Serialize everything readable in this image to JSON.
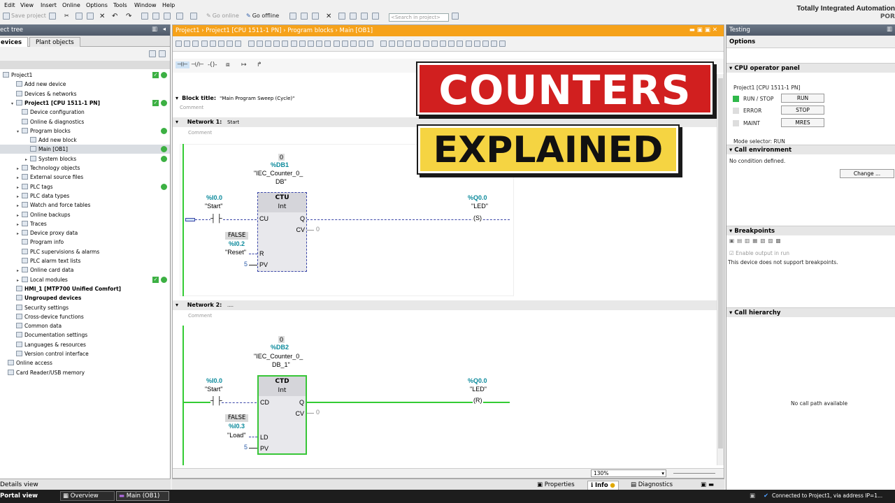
{
  "menu": [
    "Edit",
    "View",
    "Insert",
    "Online",
    "Options",
    "Tools",
    "Window",
    "Help"
  ],
  "toolbar": {
    "save": "Save project",
    "go_online": "Go online",
    "go_offline": "Go offline",
    "search_placeholder": "<Search in project>"
  },
  "app": {
    "title": "Totally Integrated Automation",
    "subtitle": "POR"
  },
  "tree": {
    "header": "ect tree",
    "tab_devices": "evices",
    "tab_plant": "Plant objects",
    "items": [
      {
        "label": "Project1",
        "indent": 0
      },
      {
        "label": "Add new device",
        "indent": 1
      },
      {
        "label": "Devices & networks",
        "indent": 1
      },
      {
        "label": "Project1 [CPU 1511-1 PN]",
        "indent": 1,
        "bold": true
      },
      {
        "label": "Device configuration",
        "indent": 2
      },
      {
        "label": "Online & diagnostics",
        "indent": 2
      },
      {
        "label": "Program blocks",
        "indent": 2
      },
      {
        "label": "Add new block",
        "indent": 3
      },
      {
        "label": "Main [OB1]",
        "indent": 3
      },
      {
        "label": "System blocks",
        "indent": 3
      },
      {
        "label": "Technology objects",
        "indent": 2
      },
      {
        "label": "External source files",
        "indent": 2
      },
      {
        "label": "PLC tags",
        "indent": 2
      },
      {
        "label": "PLC data types",
        "indent": 2
      },
      {
        "label": "Watch and force tables",
        "indent": 2
      },
      {
        "label": "Online backups",
        "indent": 2
      },
      {
        "label": "Traces",
        "indent": 2
      },
      {
        "label": "Device proxy data",
        "indent": 2
      },
      {
        "label": "Program info",
        "indent": 2
      },
      {
        "label": "PLC supervisions & alarms",
        "indent": 2
      },
      {
        "label": "PLC alarm text lists",
        "indent": 2
      },
      {
        "label": "Online card data",
        "indent": 2
      },
      {
        "label": "Local modules",
        "indent": 2
      },
      {
        "label": "HMI_1 [MTP700 Unified Comfort]",
        "indent": 1,
        "bold": true
      },
      {
        "label": "Ungrouped devices",
        "indent": 1,
        "bold": true
      },
      {
        "label": "Security settings",
        "indent": 1
      },
      {
        "label": "Cross-device functions",
        "indent": 1
      },
      {
        "label": "Common data",
        "indent": 1
      },
      {
        "label": "Documentation settings",
        "indent": 1
      },
      {
        "label": "Languages & resources",
        "indent": 1
      },
      {
        "label": "Version control interface",
        "indent": 1
      },
      {
        "label": "Online access",
        "indent": 0
      },
      {
        "label": "Card Reader/USB memory",
        "indent": 0
      }
    ],
    "details": "Details view"
  },
  "editor": {
    "breadcrumb": "Project1  ›  Project1 [CPU 1511-1 PN]  ›  Program blocks  ›  Main [OB1]",
    "block_title_label": "Block title:",
    "block_title": "\"Main Program Sweep (Cycle)\"",
    "comment": "Comment",
    "network1_label": "Network 1:",
    "network1_title": "Start",
    "network2_label": "Network 2:",
    "network2_title": "....",
    "n1": {
      "db_val": "0",
      "db_addr": "%DB1",
      "db_name1": "\"IEC_Counter_0_",
      "db_name2": "DB\"",
      "type": "CTU",
      "dtype": "Int",
      "in_addr": "%I0.0",
      "in_name": "\"Start\"",
      "pin_in": "CU",
      "pin_q": "Q",
      "pin_cv": "CV",
      "cv_val": "0",
      "r_state": "FALSE",
      "r_addr": "%I0.2",
      "r_name": "\"Reset\"",
      "pin_r": "R",
      "pv_val": "5",
      "pin_pv": "PV",
      "out_addr": "%Q0.0",
      "out_name": "\"LED\"",
      "coil": "S"
    },
    "n2": {
      "db_val": "0",
      "db_addr": "%DB2",
      "db_name1": "\"IEC_Counter_0_",
      "db_name2": "DB_1\"",
      "type": "CTD",
      "dtype": "Int",
      "in_addr": "%I0.0",
      "in_name": "\"Start\"",
      "pin_in": "CD",
      "pin_q": "Q",
      "pin_cv": "CV",
      "cv_val": "0",
      "ld_state": "FALSE",
      "ld_addr": "%I0.3",
      "ld_name": "\"Load\"",
      "pin_ld": "LD",
      "pv_val": "5",
      "pin_pv": "PV",
      "out_addr": "%Q0.0",
      "out_name": "\"LED\"",
      "coil": "R"
    },
    "zoom": "130%"
  },
  "inspector": {
    "properties": "Properties",
    "info": "Info",
    "diagnostics": "Diagnostics"
  },
  "testing": {
    "header": "Testing",
    "options": "Options",
    "cpu_panel": "CPU operator panel",
    "cpu_name": "Project1 [CPU 1511-1 PN]",
    "run_stop": "RUN / STOP",
    "run_btn": "RUN",
    "error": "ERROR",
    "stop_btn": "STOP",
    "maint": "MAINT",
    "mres_btn": "MRES",
    "mode_selector": "Mode selector:   RUN",
    "call_env": "Call environment",
    "no_condition": "No condition defined.",
    "change_btn": "Change ...",
    "breakpoints": "Breakpoints",
    "enable_output": "Enable output in run",
    "no_breakpoints": "This device does not support breakpoints.",
    "call_hierarchy": "Call hierarchy",
    "no_call_path": "No call path available"
  },
  "status": {
    "portal": "Portal view",
    "overview": "Overview",
    "main": "Main (OB1)",
    "connected": "Connected to Project1, via address IP=1..."
  },
  "overlay": {
    "line1": "COUNTERS",
    "line2": "EXPLAINED"
  },
  "colors": {
    "accent_orange": "#f6a21a",
    "energized_green": "#33cc33",
    "wire_blue": "#3a46a8",
    "overlay_red": "#d11f1f",
    "overlay_yellow": "#f5d442"
  }
}
